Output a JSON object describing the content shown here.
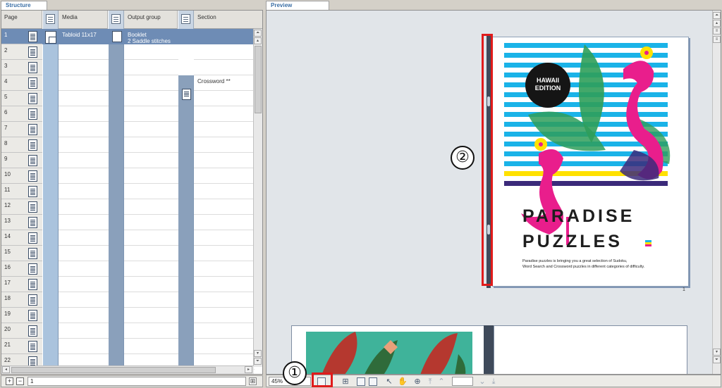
{
  "structure": {
    "tab_label": "Structure",
    "columns": {
      "page": "Page",
      "media": "Media",
      "output_group": "Output group",
      "section": "Section"
    },
    "pages": [
      "1",
      "2",
      "3",
      "4",
      "5",
      "6",
      "7",
      "8",
      "9",
      "10",
      "11",
      "12",
      "13",
      "14",
      "15",
      "16",
      "17",
      "18",
      "19",
      "20",
      "21",
      "22"
    ],
    "selected_page": "1",
    "media_value": "Tabloid 11x17",
    "output_group_line1": "Booklet",
    "output_group_line2": "2 Saddle stitches",
    "section_value": "Crossword **",
    "footer": {
      "page_field": "1",
      "add": "+",
      "remove": "−"
    }
  },
  "preview": {
    "tab_label": "Preview",
    "zoom": "45%",
    "cover": {
      "badge_line1": "HAWAII",
      "badge_line2": "EDITION",
      "title_line1": "PARADISE",
      "title_line2": "PUZZLES",
      "blurb_line1": "Paradise puzzles is bringing you a great selection of Sudoku,",
      "blurb_line2": "Word Search and Crossword puzzles in different categories of difficulty.",
      "page_number": "1"
    },
    "callouts": {
      "one": "①",
      "two": "②"
    },
    "colors": {
      "stripe_blue": "#1ab3e8",
      "stripe_purple": "#3b2a7a",
      "flamingo_pink": "#e91e8c",
      "leaf_green": "#2f9e5a",
      "highlight_red": "#e01b1b",
      "title_dark": "#1e1e1e"
    },
    "toolbar_icons": [
      "spread-view-icon",
      "thumbnails-icon",
      "single-page-icon",
      "facing-pages-icon",
      "select-tool-icon",
      "hand-tool-icon",
      "zoom-tool-icon",
      "first-page-icon",
      "previous-page-icon",
      "next-page-icon",
      "last-page-icon"
    ]
  }
}
